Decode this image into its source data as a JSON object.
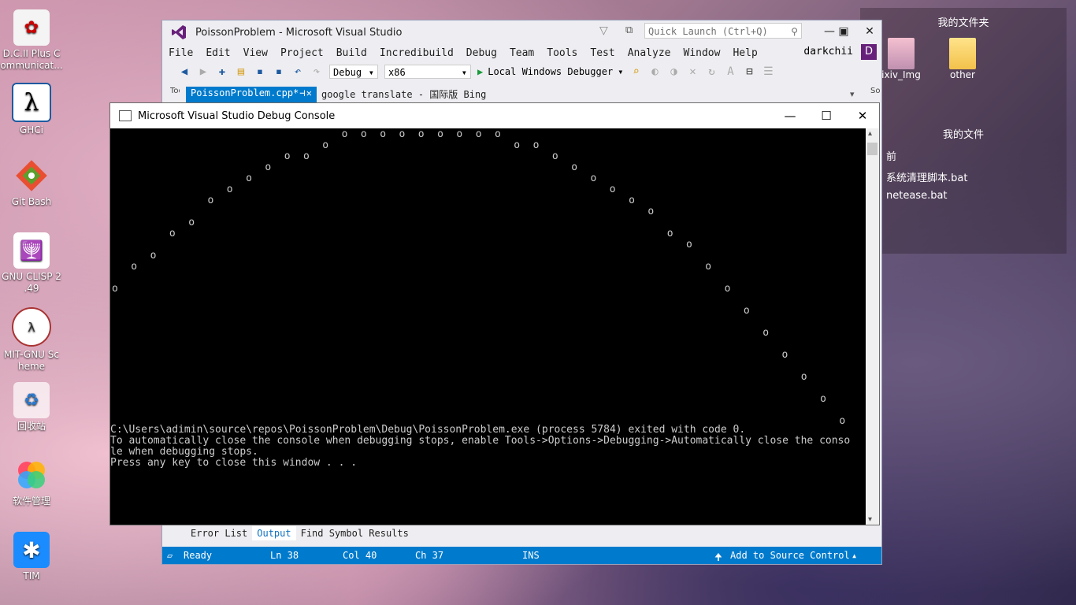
{
  "desktop": {
    "icons": [
      {
        "label": "D.C.II Plus C ommunicat...",
        "icon": "dc2-icon"
      },
      {
        "label": "GHCi",
        "icon": "lambda-icon"
      },
      {
        "label": "Git Bash",
        "icon": "git-icon"
      },
      {
        "label": "GNU CLISP 2 .49",
        "icon": "clisp-icon"
      },
      {
        "label": "MIT-GNU Sc heme",
        "icon": "scheme-icon"
      },
      {
        "label": "回收站",
        "icon": "recycle-bin-icon"
      },
      {
        "label": "软件管理",
        "icon": "software-manager-icon"
      },
      {
        "label": "TIM",
        "icon": "tim-icon"
      }
    ],
    "panel_top_title": "我的文件夹",
    "folders": [
      {
        "label": "ixiv_Img"
      },
      {
        "label": "other"
      }
    ],
    "panel_bottom_title": "我的文件",
    "files": [
      "前",
      "系统清理脚本.bat",
      "netease.bat"
    ]
  },
  "vs": {
    "title": "PoissonProblem - Microsoft Visual Studio",
    "quick_launch_placeholder": "Quick Launch (Ctrl+Q)",
    "menu": [
      "File",
      "Edit",
      "View",
      "Project",
      "Build",
      "Incredibuild",
      "Debug",
      "Team",
      "Tools",
      "Test",
      "Analyze",
      "Window",
      "Help"
    ],
    "user": "darkchii",
    "user_initial": "D",
    "config": "Debug",
    "platform": "x86",
    "debugger": "Local Windows Debugger",
    "tabs": {
      "active": "PoissonProblem.cpp*",
      "other": "google translate - 国际版 Bing"
    },
    "side_left": "Toolbox",
    "side_right": "Solution",
    "bottom_tabs": [
      "Error List",
      "Output",
      "Find Symbol Results"
    ],
    "status": {
      "ready": "Ready",
      "ln": "Ln 38",
      "col": "Col 40",
      "ch": "Ch 37",
      "ins": "INS",
      "source_control": "Add to Source Control"
    }
  },
  "console": {
    "title": "Microsoft Visual Studio Debug Console",
    "glyph": "o",
    "output_lines": [
      "C:\\Users\\adimin\\source\\repos\\PoissonProblem\\Debug\\PoissonProblem.exe (process 5784) exited with code 0.",
      "To automatically close the console when debugging stops, enable Tools->Options->Debugging->Automatically close the conso",
      "le when debugging stops.",
      "Press any key to close this window . . ."
    ],
    "curve_points": [
      {
        "col": 0,
        "row": 14
      },
      {
        "col": 1,
        "row": 12
      },
      {
        "col": 2,
        "row": 11
      },
      {
        "col": 3,
        "row": 9
      },
      {
        "col": 4,
        "row": 8
      },
      {
        "col": 5,
        "row": 6
      },
      {
        "col": 6,
        "row": 5
      },
      {
        "col": 7,
        "row": 4
      },
      {
        "col": 8,
        "row": 3
      },
      {
        "col": 9,
        "row": 2
      },
      {
        "col": 10,
        "row": 2
      },
      {
        "col": 11,
        "row": 1
      },
      {
        "col": 12,
        "row": 0
      },
      {
        "col": 13,
        "row": 0
      },
      {
        "col": 14,
        "row": 0
      },
      {
        "col": 15,
        "row": 0
      },
      {
        "col": 16,
        "row": 0
      },
      {
        "col": 17,
        "row": 0
      },
      {
        "col": 18,
        "row": 0
      },
      {
        "col": 19,
        "row": 0
      },
      {
        "col": 20,
        "row": 0
      },
      {
        "col": 21,
        "row": 1
      },
      {
        "col": 22,
        "row": 1
      },
      {
        "col": 23,
        "row": 2
      },
      {
        "col": 24,
        "row": 3
      },
      {
        "col": 25,
        "row": 4
      },
      {
        "col": 26,
        "row": 5
      },
      {
        "col": 27,
        "row": 6
      },
      {
        "col": 28,
        "row": 7
      },
      {
        "col": 29,
        "row": 9
      },
      {
        "col": 30,
        "row": 10
      },
      {
        "col": 31,
        "row": 12
      },
      {
        "col": 32,
        "row": 14
      },
      {
        "col": 33,
        "row": 16
      },
      {
        "col": 34,
        "row": 18
      },
      {
        "col": 35,
        "row": 20
      },
      {
        "col": 36,
        "row": 22
      },
      {
        "col": 37,
        "row": 24
      },
      {
        "col": 38,
        "row": 26
      }
    ]
  }
}
